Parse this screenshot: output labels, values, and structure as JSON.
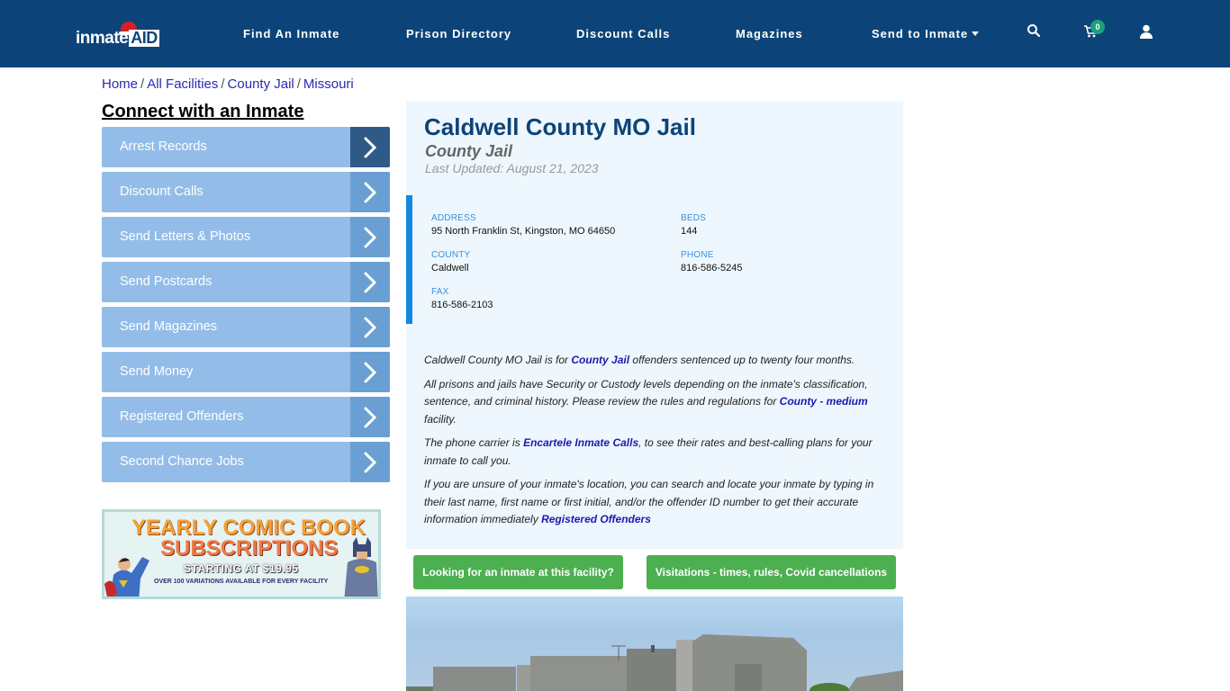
{
  "brand": {
    "logo_text": "inmate",
    "logo_accent": "AID",
    "primary_color": "#0c4479",
    "accent_color": "#1788e0",
    "button_color": "#4caf50"
  },
  "nav": {
    "items": [
      {
        "label": "Find An Inmate"
      },
      {
        "label": "Prison Directory"
      },
      {
        "label": "Discount Calls"
      },
      {
        "label": "Magazines"
      },
      {
        "label": "Send to Inmate",
        "has_dropdown": true
      }
    ],
    "icons": [
      "search-icon",
      "cart-icon",
      "user-icon"
    ],
    "cart_count": "0"
  },
  "breadcrumb": [
    {
      "label": "Home"
    },
    {
      "label": "All Facilities"
    },
    {
      "label": "County Jail"
    },
    {
      "label": "Missouri"
    }
  ],
  "sidebar": {
    "title": "Connect with an Inmate",
    "items": [
      {
        "label": "Arrest Records",
        "active": true
      },
      {
        "label": "Discount Calls"
      },
      {
        "label": "Send Letters & Photos"
      },
      {
        "label": "Send Postcards"
      },
      {
        "label": "Send Magazines"
      },
      {
        "label": "Send Money"
      },
      {
        "label": "Registered Offenders"
      },
      {
        "label": "Second Chance Jobs"
      }
    ],
    "promo": {
      "line1": "YEARLY COMIC BOOK",
      "line2": "SUBSCRIPTIONS",
      "line3": "STARTING AT $19.95",
      "line4": "OVER 100 VARIATIONS AVAILABLE FOR EVERY FACILITY"
    }
  },
  "facility": {
    "name": "Caldwell County MO Jail",
    "type": "County Jail",
    "last_updated": "Last Updated: August 21, 2023",
    "info": {
      "address": {
        "label": "ADDRESS",
        "value": "95 North Franklin St, Kingston, MO 64650"
      },
      "beds": {
        "label": "BEDS",
        "value": "144"
      },
      "county": {
        "label": "COUNTY",
        "value": "Caldwell"
      },
      "phone": {
        "label": "PHONE",
        "value": "816-586-5245"
      },
      "fax": {
        "label": "FAX",
        "value": "816-586-2103"
      }
    },
    "description": {
      "p1_a": "Caldwell County MO Jail is for ",
      "p1_link": "County Jail",
      "p1_b": " offenders sentenced up to twenty four months.",
      "p2_a": "All prisons and jails have Security or Custody levels depending on the inmate's classification, sentence, and criminal history. Please review the rules and regulations for ",
      "p2_link": "County - medium",
      "p2_b": " facility.",
      "p3_a": "The phone carrier is ",
      "p3_link": "Encartele Inmate Calls",
      "p3_b": ", to see their rates and best-calling plans for your inmate to call you.",
      "p4_a": "If you are unsure of your inmate's location, you can search and locate your inmate by typing in their last name, first name or first initial, and/or the offender ID number to get their accurate information immediately ",
      "p4_link": "Registered Offenders"
    }
  },
  "buttons": {
    "find_inmate": "Looking for an inmate at this facility?",
    "visitations": "Visitations - times, rules, Covid cancellations"
  }
}
